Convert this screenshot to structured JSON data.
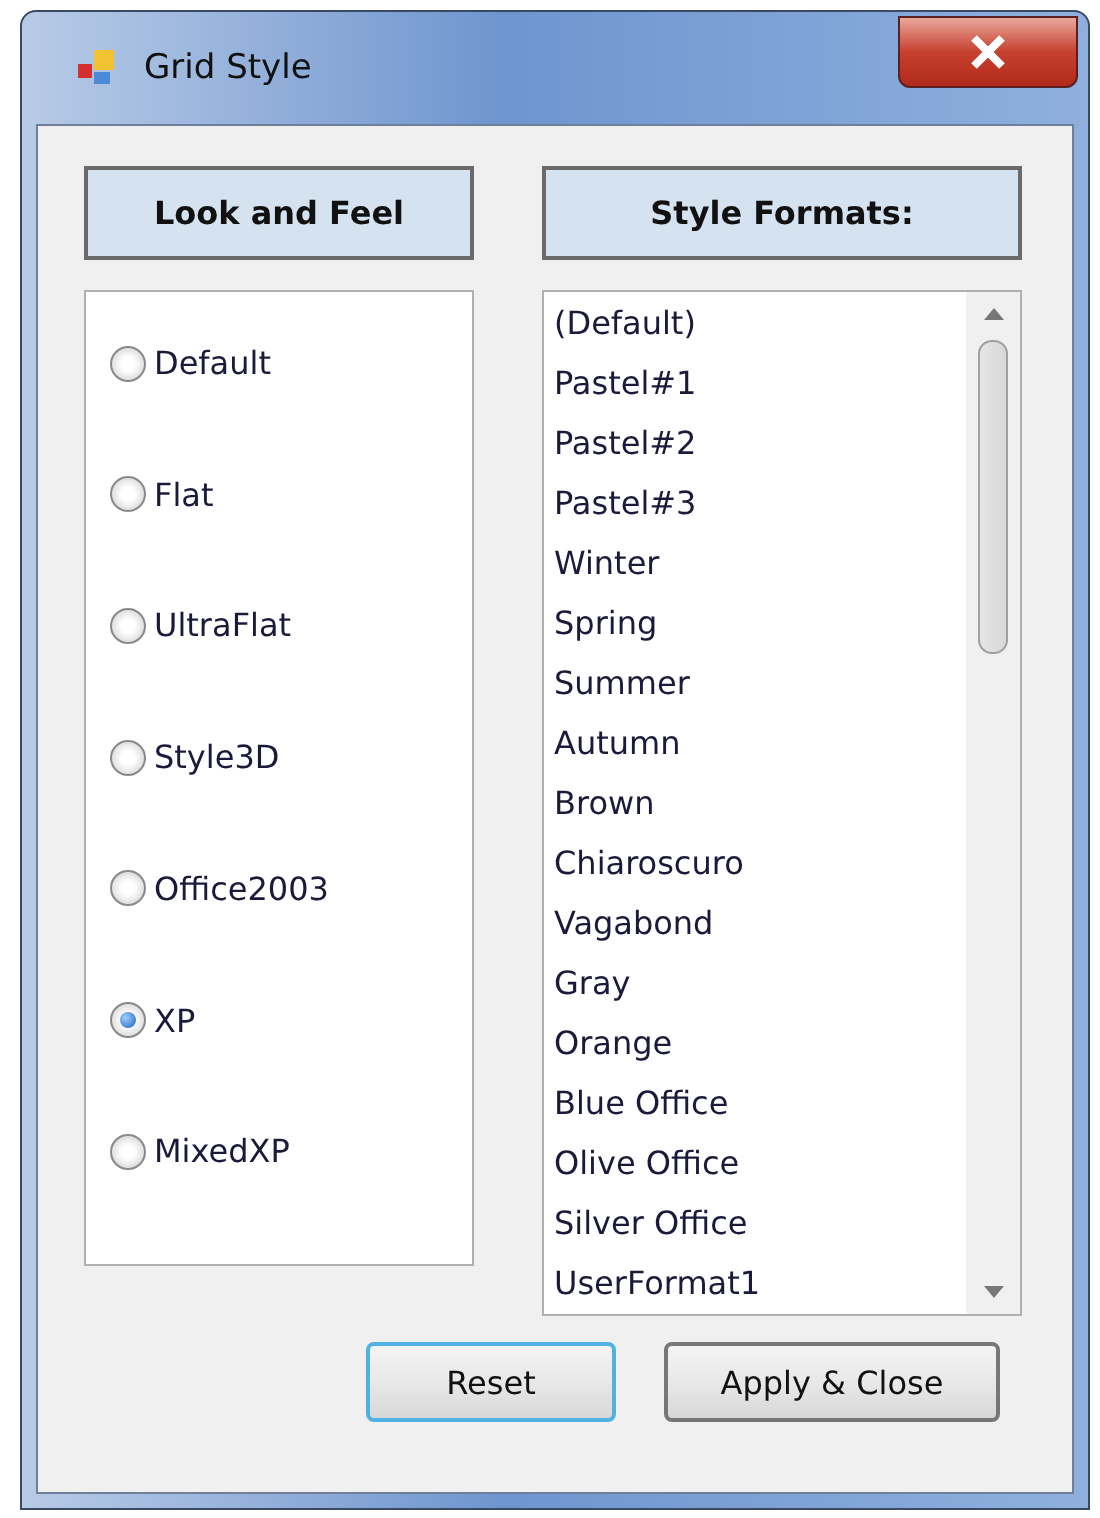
{
  "window": {
    "title": "Grid Style"
  },
  "look_and_feel": {
    "heading": "Look and Feel",
    "options": [
      {
        "label": "Default",
        "selected": false
      },
      {
        "label": "Flat",
        "selected": false
      },
      {
        "label": "UltraFlat",
        "selected": false
      },
      {
        "label": "Style3D",
        "selected": false
      },
      {
        "label": "Office2003",
        "selected": false
      },
      {
        "label": "XP",
        "selected": true
      },
      {
        "label": "MixedXP",
        "selected": false
      }
    ]
  },
  "style_formats": {
    "heading": "Style Formats:",
    "items": [
      "(Default)",
      "Pastel#1",
      "Pastel#2",
      "Pastel#3",
      "Winter",
      "Spring",
      "Summer",
      "Autumn",
      "Brown",
      "Chiaroscuro",
      "Vagabond",
      "Gray",
      "Orange",
      "Blue Office",
      "Olive Office",
      "Silver Office",
      "UserFormat1"
    ]
  },
  "buttons": [
    {
      "label": "Reset",
      "focused": true
    },
    {
      "label": "Apply & Close",
      "focused": false
    }
  ]
}
